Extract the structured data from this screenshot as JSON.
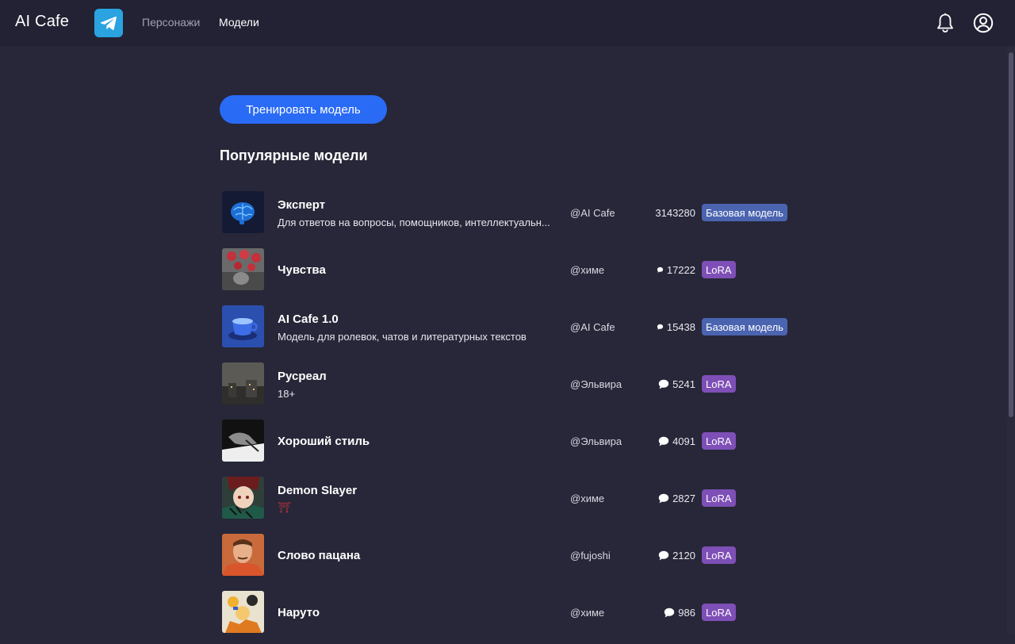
{
  "header": {
    "brand": "AI Cafe",
    "nav": [
      {
        "label": "Персонажи"
      },
      {
        "label": "Модели"
      }
    ]
  },
  "main": {
    "train_button": "Тренировать модель",
    "section_title": "Популярные модели",
    "models": [
      {
        "name": "Эксперт",
        "description": "Для ответов на вопросы, помощников, интеллектуальн...",
        "author": "@AI Cafe",
        "count": "3143280",
        "badge": "Базовая модель",
        "badge_type": "base",
        "icon": "none"
      },
      {
        "name": "Чувства",
        "description": "",
        "author": "@химе",
        "count": "17222",
        "badge": "LoRA",
        "badge_type": "lora",
        "icon": "small-chat-icon"
      },
      {
        "name": "AI Cafe 1.0",
        "description": "Модель для ролевок, чатов и литературных текстов",
        "author": "@AI Cafe",
        "count": "15438",
        "badge": "Базовая модель",
        "badge_type": "base",
        "icon": "small-chat-icon"
      },
      {
        "name": "Русреал",
        "description": "18+",
        "author": "@Эльвира",
        "count": "5241",
        "badge": "LoRA",
        "badge_type": "lora",
        "icon": "chat-icon"
      },
      {
        "name": "Хороший стиль",
        "description": "",
        "author": "@Эльвира",
        "count": "4091",
        "badge": "LoRA",
        "badge_type": "lora",
        "icon": "chat-icon"
      },
      {
        "name": "Demon Slayer",
        "description": "⛩",
        "author": "@химе",
        "count": "2827",
        "badge": "LoRA",
        "badge_type": "lora",
        "icon": "chat-icon"
      },
      {
        "name": "Слово пацана",
        "description": "",
        "author": "@fujoshi",
        "count": "2120",
        "badge": "LoRA",
        "badge_type": "lora",
        "icon": "chat-icon"
      },
      {
        "name": "Наруто",
        "description": "",
        "author": "@химе",
        "count": "986",
        "badge": "LoRA",
        "badge_type": "lora",
        "icon": "chat-icon"
      }
    ]
  },
  "colors": {
    "background": "#272739",
    "header": "#222234",
    "primary_button": "#2a6bf5",
    "badge_base": "#4b64b0",
    "badge_lora": "#7e4fb6",
    "telegram": "#2aa3e0"
  }
}
